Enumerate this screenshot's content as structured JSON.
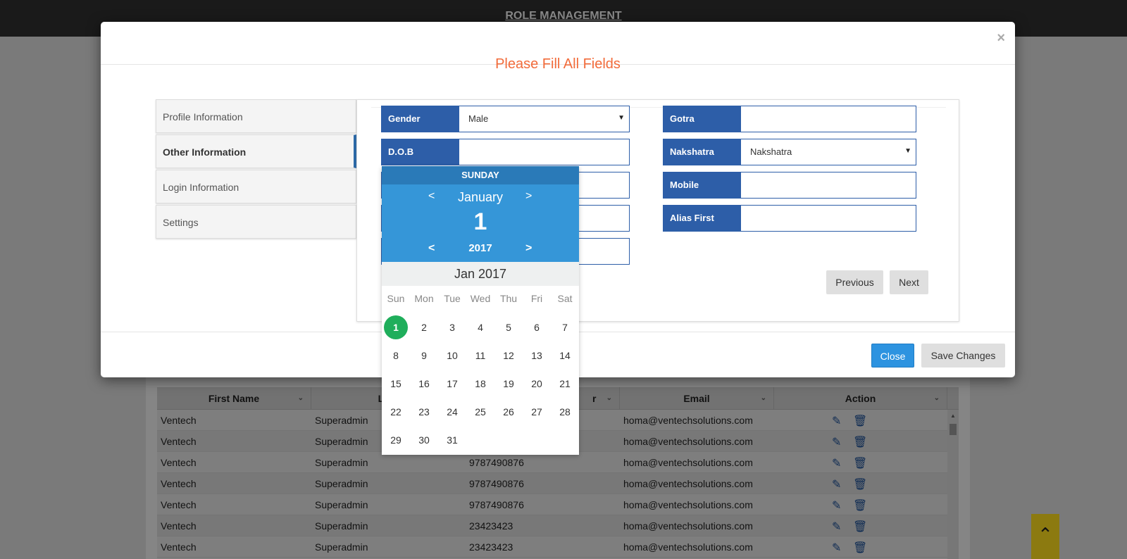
{
  "background": {
    "page_title": "ROLE MANAGEMENT",
    "grid": {
      "columns": [
        "First Name",
        "Last",
        "r",
        "Email",
        "Action"
      ],
      "rows": [
        [
          "Ventech",
          "Superadmin",
          "",
          "homa@ventechsolutions.com"
        ],
        [
          "Ventech",
          "Superadmin",
          "",
          "homa@ventechsolutions.com"
        ],
        [
          "Ventech",
          "Superadmin",
          "9787490876",
          "homa@ventechsolutions.com"
        ],
        [
          "Ventech",
          "Superadmin",
          "9787490876",
          "homa@ventechsolutions.com"
        ],
        [
          "Ventech",
          "Superadmin",
          "9787490876",
          "homa@ventechsolutions.com"
        ],
        [
          "Ventech",
          "Superadmin",
          "23423423",
          "homa@ventechsolutions.com"
        ],
        [
          "Ventech",
          "Superadmin",
          "23423423",
          "homa@ventechsolutions.com"
        ]
      ],
      "icons": {
        "edit": "pencil-icon",
        "delete": "trash-icon"
      }
    },
    "scroll_top_icon": "chevron-up-icon"
  },
  "modal": {
    "title": "Please Fill All Fields",
    "close_glyph": "×",
    "tabs": [
      {
        "label": "Profile Information",
        "active": false
      },
      {
        "label": "Other Information",
        "active": true
      },
      {
        "label": "Login Information",
        "active": false
      },
      {
        "label": "Settings",
        "active": false
      }
    ],
    "fields": {
      "gender": {
        "label": "Gender",
        "value": "Male"
      },
      "dob": {
        "label": "D.O.B",
        "value": ""
      },
      "gotra": {
        "label": "Gotra",
        "value": ""
      },
      "nakshatra": {
        "label": "Nakshatra",
        "value": "Nakshatra"
      },
      "mobile": {
        "label": "Mobile",
        "value": ""
      },
      "alias_first_name": {
        "label": "Alias First Name",
        "value": ""
      }
    },
    "buttons": {
      "previous": "Previous",
      "next": "Next",
      "close": "Close",
      "save": "Save Changes"
    }
  },
  "datepicker": {
    "weekday": "SUNDAY",
    "month": "January",
    "date": "1",
    "year": "2017",
    "caption": "Jan 2017",
    "prev_glyph": "<",
    "next_glyph": ">",
    "weekdays": [
      "Sun",
      "Mon",
      "Tue",
      "Wed",
      "Thu",
      "Fri",
      "Sat"
    ],
    "days": [
      "1",
      "2",
      "3",
      "4",
      "5",
      "6",
      "7",
      "8",
      "9",
      "10",
      "11",
      "12",
      "13",
      "14",
      "15",
      "16",
      "17",
      "18",
      "19",
      "20",
      "21",
      "22",
      "23",
      "24",
      "25",
      "26",
      "27",
      "28",
      "29",
      "30",
      "31"
    ],
    "selected_day": "1",
    "colors": {
      "header": "#3596d8",
      "selected": "#1fae5b"
    }
  },
  "colors": {
    "accent": "#2d5ea8",
    "title": "#f26b3a",
    "primary_button": "#2d93e0"
  }
}
